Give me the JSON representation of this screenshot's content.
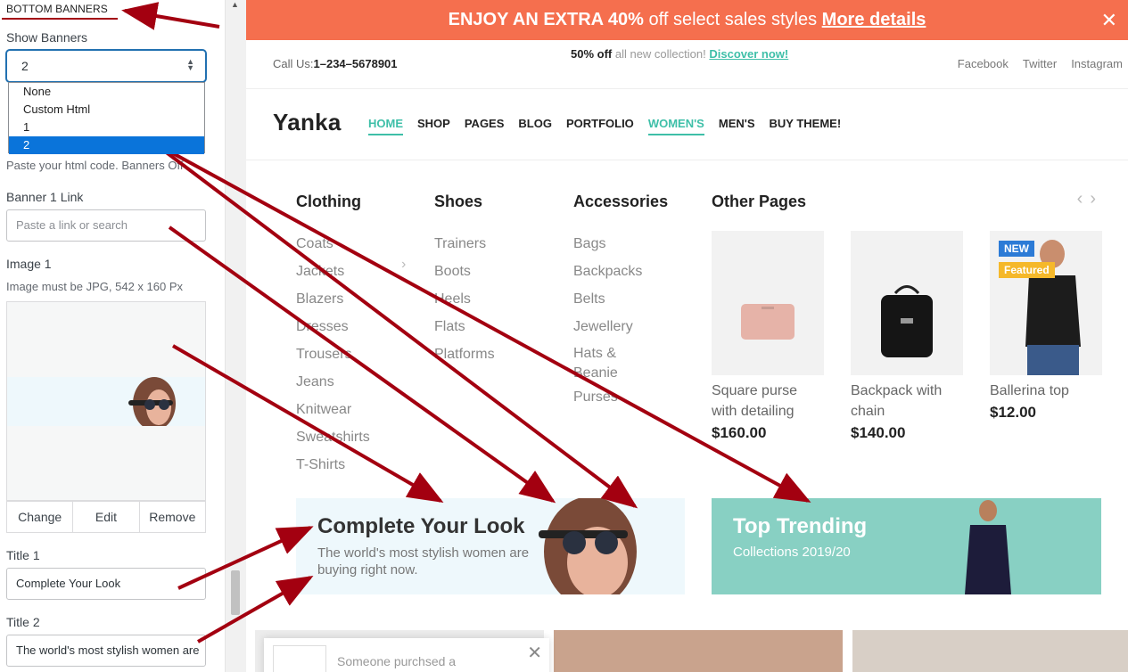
{
  "panel": {
    "section_title": "BOTTOM BANNERS",
    "show_banners_label": "Show Banners",
    "show_banners_value": "2",
    "options": [
      "None",
      "Custom Html",
      "1",
      "2"
    ],
    "html_desc": "Paste your html code. Banners Off",
    "banner1_link_label": "Banner 1 Link",
    "banner1_link_placeholder": "Paste a link or search",
    "image1_label": "Image 1",
    "image1_desc": "Image must be JPG, 542 x 160 Px",
    "image_buttons": [
      "Change",
      "Edit",
      "Remove"
    ],
    "title1_label": "Title 1",
    "title1_value": "Complete Your Look",
    "title2_label": "Title 2",
    "title2_value": "The world's most stylish women are"
  },
  "store": {
    "promo": {
      "bold": "ENJOY AN EXTRA 40%",
      "text": " off select sales styles ",
      "link": "More details"
    },
    "call_prefix": "Call Us:",
    "phone": "1–234–5678901",
    "mid_bold": "50% off",
    "mid_text": " all new collection! ",
    "mid_link": "Discover now!",
    "social": [
      "Facebook",
      "Twitter",
      "Instagram"
    ],
    "logo": "Yanka",
    "nav": [
      "HOME",
      "SHOP",
      "PAGES",
      "BLOG",
      "PORTFOLIO",
      "WOMEN'S",
      "MEN'S",
      "BUY THEME!"
    ],
    "columns": [
      {
        "title": "Clothing",
        "items": [
          "Coats",
          "Jackets",
          "Blazers",
          "Dresses",
          "Trousers",
          "Jeans",
          "Knitwear",
          "Sweatshirts",
          "T-Shirts"
        ]
      },
      {
        "title": "Shoes",
        "items": [
          "Trainers",
          "Boots",
          "Heels",
          "Flats",
          "Platforms"
        ]
      },
      {
        "title": "Accessories",
        "items": [
          "Bags",
          "Backpacks",
          "Belts",
          "Jewellery",
          "Hats &",
          "Beanie",
          "Purses"
        ]
      }
    ],
    "other_pages_title": "Other Pages",
    "products": [
      {
        "name": "Square purse with detailing",
        "price": "$160.00"
      },
      {
        "name": "Backpack with chain",
        "price": "$140.00"
      },
      {
        "name": "Ballerina top",
        "price": "$12.00"
      }
    ],
    "badges": [
      "NEW",
      "Featured"
    ],
    "banner1": {
      "title": "Complete Your Look",
      "subtitle": "The world's most stylish women are buying right now."
    },
    "banner2": {
      "title": "Top Trending",
      "subtitle": "Collections 2019/20"
    },
    "toast_text": "Someone purchsed a"
  },
  "colors": {
    "accent": "#3ebfa8",
    "promo": "#f56f4e",
    "annotation_arrow": "#a30010",
    "select_highlight": "#0a74da",
    "banner2_bg": "#88d0c3"
  }
}
